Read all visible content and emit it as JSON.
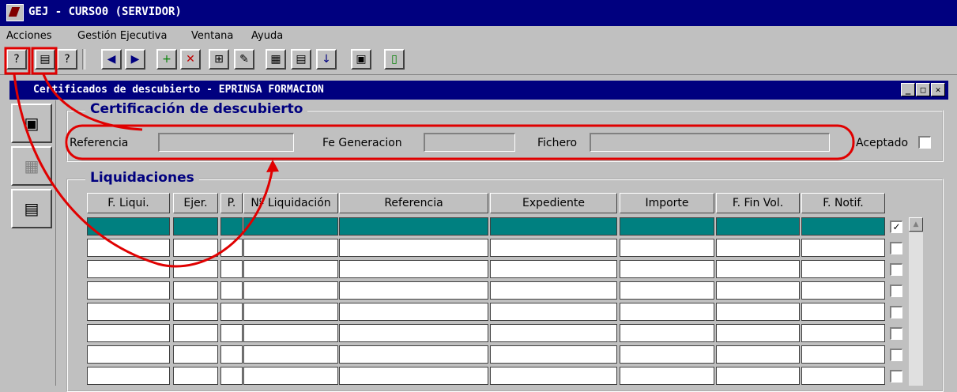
{
  "app": {
    "title": "GEJ - CURSO0 (SERVIDOR)"
  },
  "menu": {
    "items": [
      "Acciones",
      "Gestión Ejecutiva",
      "Ventana",
      "Ayuda"
    ]
  },
  "toolbar": {
    "icons": [
      "query-help-icon",
      "query-run-icon",
      "query-count-icon",
      "prev-record-icon",
      "next-record-icon",
      "insert-record-icon",
      "delete-record-icon",
      "duplicate-record-icon",
      "edit-icon",
      "list-values-icon",
      "notes-icon",
      "download-icon",
      "save-icon",
      "exit-icon"
    ]
  },
  "document": {
    "title": "Certificados de descubierto - EPRINSA FORMACION"
  },
  "cert_section": {
    "title": "Certificación de descubierto",
    "referencia_label": "Referencia",
    "fe_generacion_label": "Fe Generacion",
    "fichero_label": "Fichero",
    "aceptado_label": "Aceptado"
  },
  "liquidaciones": {
    "title": "Liquidaciones",
    "columns": [
      "F. Liqui.",
      "Ejer.",
      "P.",
      "Nº Liquidación",
      "Referencia",
      "Expediente",
      "Importe",
      "F. Fin Vol.",
      "F. Notif."
    ],
    "checked_marks": [
      "✓",
      "",
      "",
      "",
      "",
      "",
      "",
      ""
    ]
  },
  "annotation_color": "#e00000"
}
